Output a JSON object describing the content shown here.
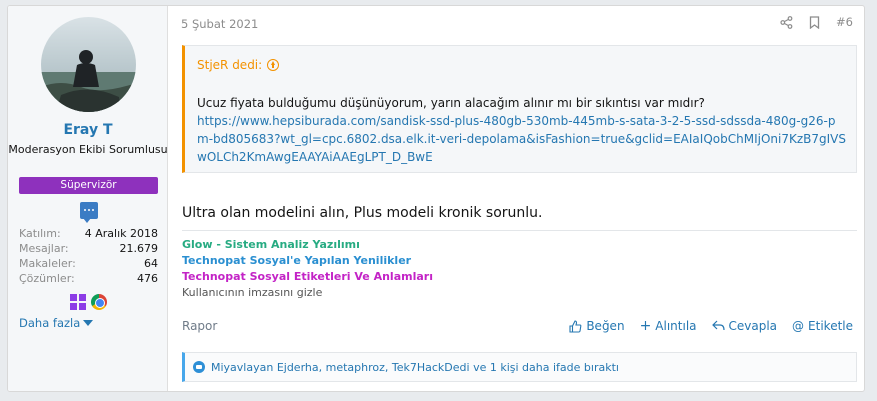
{
  "user": {
    "name": "Eray T",
    "title": "Moderasyon Ekibi Sorumlusu",
    "banner": "Süpervizör",
    "stats": [
      {
        "label": "Katılım:",
        "value": "4 Aralık 2018"
      },
      {
        "label": "Mesajlar:",
        "value": "21.679"
      },
      {
        "label": "Makaleler:",
        "value": "64"
      },
      {
        "label": "Çözümler:",
        "value": "476"
      }
    ],
    "more_label": "Daha fazla"
  },
  "post": {
    "date": "5 Şubat 2021",
    "number": "#6",
    "quote": {
      "author": "StjeR dedi:",
      "text": "Ucuz fiyata bulduğumu düşünüyorum, yarın alacağım alınır mı bir sıkıntısı var mıdır?",
      "link": "https://www.hepsiburada.com/sandisk-ssd-plus-480gb-530mb-445mb-s-sata-3-2-5-ssd-sdssda-480g-g26-pm-bd805683?wt_gl=cpc.6802.dsa.elk.it-veri-depolama&isFashion=true&gclid=EAIaIQobChMIjOni7KzB7gIVSwOLCh2KmAwgEAAYAiAAEgLPT_D_BwE"
    },
    "message": "Ultra olan modelini alın, Plus modeli kronik sorunlu.",
    "signature": [
      "Glow - Sistem Analiz Yazılımı",
      "Technopat Sosyal'e Yapılan Yenilikler",
      "Technopat Sosyal Etiketleri Ve Anlamları",
      "Kullanıcının imzasını gizle"
    ],
    "report_label": "Rapor",
    "actions": {
      "like": "Beğen",
      "quote": "Alıntıla",
      "reply": "Cevapla",
      "tag": "Etiketle"
    },
    "reactions": "Miyavlayan Ejderha, metaphroz, Tek7HackDedi ve 1 kişi daha ifade bıraktı"
  },
  "colors": {
    "accent": "#2577b1",
    "quote_border": "#f39200",
    "banner": "#8e31bd"
  }
}
